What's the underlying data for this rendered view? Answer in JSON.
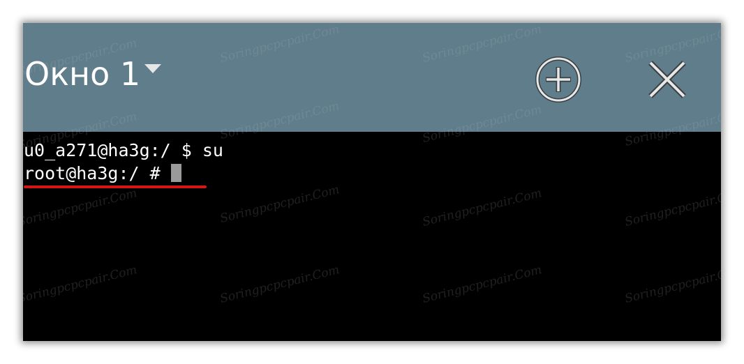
{
  "window": {
    "title": "Окно 1"
  },
  "toolbar": {
    "add_icon": "circle-plus-icon",
    "close_icon": "close-icon"
  },
  "terminal": {
    "lines": [
      "u0_a271@ha3g:/ $ su",
      "root@ha3g:/ #"
    ]
  },
  "watermark": {
    "text": "Sоringрсрсpair.Com"
  },
  "colors": {
    "titlebar_bg": "#5f7d8b",
    "terminal_bg": "#000000",
    "underline": "#d41616",
    "cursor": "#9a9a9a"
  }
}
